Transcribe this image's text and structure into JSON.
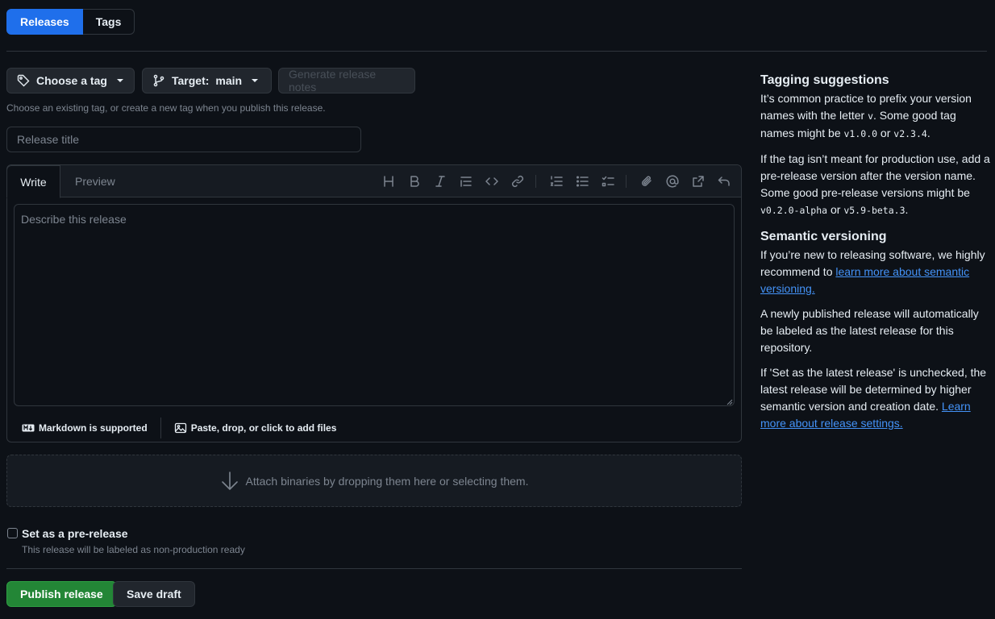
{
  "tabs": {
    "releases": "Releases",
    "tags": "Tags"
  },
  "toolbar": {
    "choose_tag": "Choose a tag",
    "target_prefix": "Target:",
    "target_value": "main",
    "generate_notes": "Generate release notes",
    "hint": "Choose an existing tag, or create a new tag when you publish this release."
  },
  "release_title": {
    "placeholder": "Release title"
  },
  "editor": {
    "tab_write": "Write",
    "tab_preview": "Preview",
    "placeholder": "Describe this release",
    "markdown_supported": "Markdown is supported",
    "attach_files": "Paste, drop, or click to add files",
    "toolbar_icons": [
      "heading-icon",
      "bold-icon",
      "italic-icon",
      "quote-icon",
      "code-icon",
      "link-icon",
      "ordered-list-icon",
      "unordered-list-icon",
      "task-list-icon",
      "attach-icon",
      "mention-icon",
      "cross-reference-icon",
      "undo-icon"
    ]
  },
  "attach_binaries": "Attach binaries by dropping them here or selecting them.",
  "prerelease": {
    "label": "Set as a pre-release",
    "description": "This release will be labeled as non-production ready",
    "checked": false
  },
  "actions": {
    "publish": "Publish release",
    "save_draft": "Save draft"
  },
  "sidebar": {
    "tagging_title": "Tagging suggestions",
    "tagging_p1_a": "It’s common practice to prefix your version names with the letter ",
    "tagging_p1_v": "v",
    "tagging_p1_b": ". Some good tag names might be ",
    "tag_example_1": "v1.0.0",
    "or_1": " or ",
    "tag_example_2": "v2.3.4",
    "period_1": ".",
    "tagging_p2": "If the tag isn’t meant for production use, add a pre-release version after the version name. Some good pre-release versions might be ",
    "pre_example_1": "v0.2.0-alpha",
    "or_2": " or ",
    "pre_example_2": "v5.9-beta.3",
    "period_2": ".",
    "semver_title": "Semantic versioning",
    "semver_p1": "If you’re new to releasing software, we highly recommend to ",
    "semver_link": "learn more about semantic versioning.",
    "semver_p2": "A newly published release will automatically be labeled as the latest release for this repository.",
    "semver_p3": "If 'Set as the latest release' is unchecked, the latest release will be determined by higher semantic version and creation date. ",
    "semver_link2": "Learn more about release settings."
  },
  "colors": {
    "accent": "#1f6feb",
    "publish": "#238636",
    "link": "#4493f8",
    "background": "#0d1117"
  }
}
